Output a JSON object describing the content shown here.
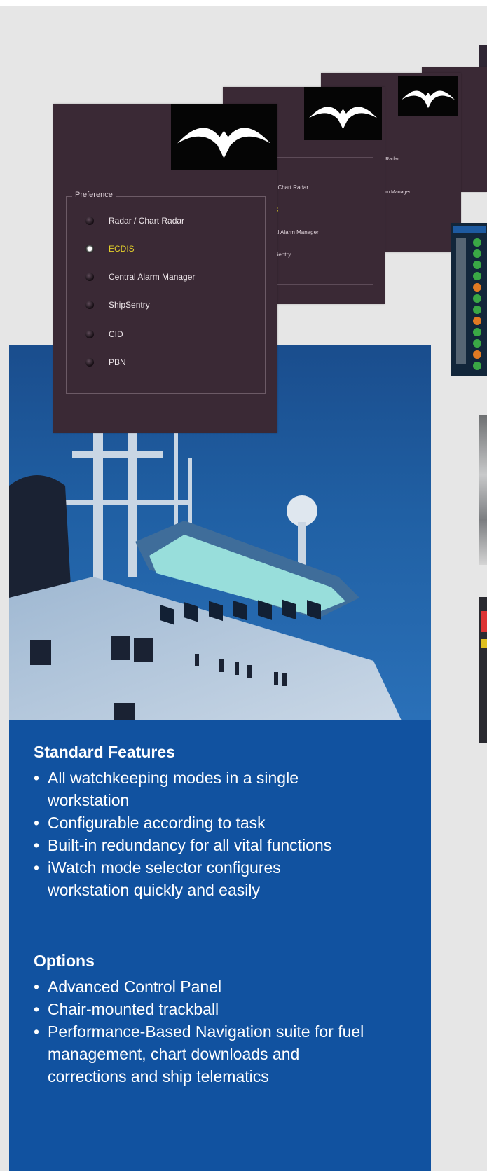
{
  "panel": {
    "legend": "Preference",
    "options": [
      {
        "label": "Radar / Chart Radar",
        "selected": false
      },
      {
        "label": "ECDIS",
        "selected": true
      },
      {
        "label": "Central Alarm Manager",
        "selected": false
      },
      {
        "label": "ShipSentry",
        "selected": false
      },
      {
        "label": "CID",
        "selected": false
      },
      {
        "label": "PBN",
        "selected": false
      }
    ]
  },
  "back_panel_1": {
    "items": [
      "/ Chart Radar",
      "S",
      "al Alarm Manager",
      "Sentry"
    ]
  },
  "back_panel_2": {
    "items": [
      "rt Radar",
      "arm Manager"
    ]
  },
  "features": {
    "standard_title": "Standard Features",
    "standard": [
      "All watchkeeping modes in a single workstation",
      "Configurable according to task",
      "Built-in redundancy for all vital functions",
      "iWatch mode selector configures workstation quickly and easily"
    ],
    "options_title": "Options",
    "options": [
      "Advanced Control Panel",
      "Chair-mounted trackball",
      "Performance-Based Navigation suite for fuel management, chart downloads and corrections and ship telematics"
    ]
  },
  "colors": {
    "window_bg": "#3a2935",
    "selected_text": "#e2cf2a",
    "features_bg": "#1152a0"
  },
  "icons": {
    "logo": "bird-wings-logo",
    "radio": "radio-button"
  }
}
